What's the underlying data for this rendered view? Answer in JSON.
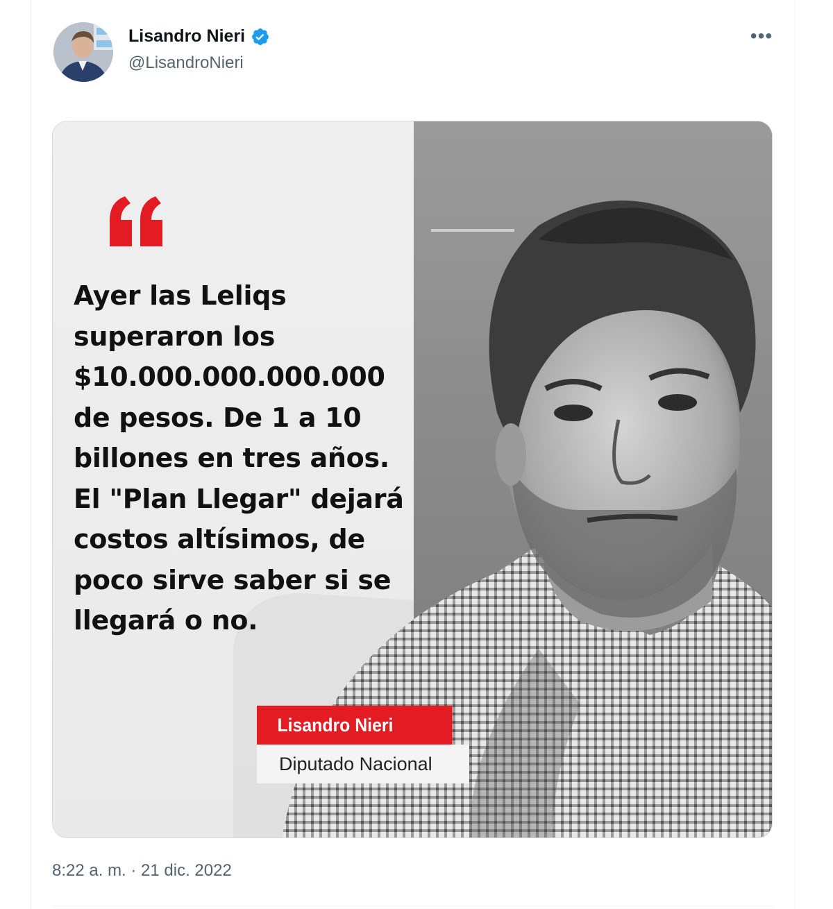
{
  "author": {
    "name": "Lisandro Nieri",
    "handle": "@LisandroNieri",
    "verified": true,
    "avatar_icon": "user-avatar"
  },
  "menu": {
    "more_icon": "more-horizontal-icon",
    "more_glyph": "•••"
  },
  "media": {
    "quote_text": "Ayer las Leliqs\nsuperaron los\n$10.000.000.000.000\nde pesos. De 1 a 10\nbillones en tres años.\nEl \"Plan Llegar\" dejará\ncostos altísimos, de\npoco sirve saber si se\nllegará o no.",
    "caption_name": "Lisandro Nieri",
    "caption_role": "Diputado Nacional",
    "accent_color": "#e31b23"
  },
  "timestamp": "8:22 a. m. · 21 dic. 2022",
  "colors": {
    "verified_blue": "#1d9bf0",
    "secondary_text": "#536471",
    "primary_text": "#0f1419"
  }
}
